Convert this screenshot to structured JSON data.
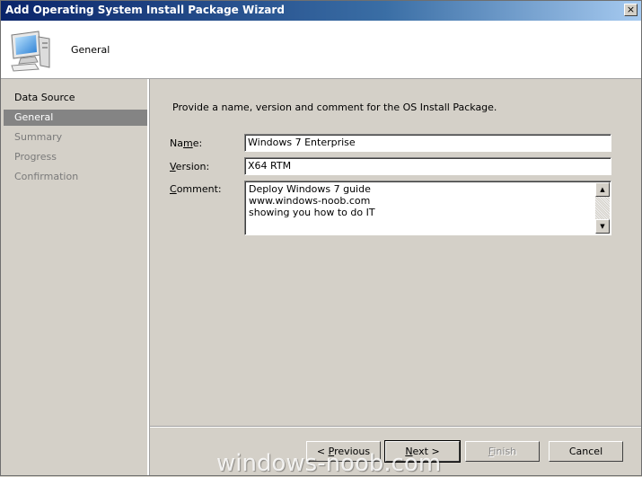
{
  "window": {
    "title": "Add Operating System Install Package Wizard",
    "close_glyph": "×"
  },
  "header": {
    "page_title": "General",
    "icon": "computer-monitor-icon"
  },
  "sidebar": {
    "steps": [
      {
        "label": "Data Source",
        "state": "completed"
      },
      {
        "label": "General",
        "state": "current"
      },
      {
        "label": "Summary",
        "state": "pending"
      },
      {
        "label": "Progress",
        "state": "pending"
      },
      {
        "label": "Confirmation",
        "state": "pending"
      }
    ]
  },
  "content": {
    "intro": "Provide a name, version and comment for the OS Install Package.",
    "name": {
      "label_pre": "Na",
      "label_accel": "m",
      "label_post": "e:",
      "value": "Windows 7 Enterprise"
    },
    "version": {
      "label_pre": "",
      "label_accel": "V",
      "label_post": "ersion:",
      "value": "X64 RTM"
    },
    "comment": {
      "label_pre": "",
      "label_accel": "C",
      "label_post": "omment:",
      "lines": [
        "Deploy Windows 7 guide",
        "www.windows-noob.com",
        "showing you how to do IT"
      ]
    },
    "scroll_up_glyph": "▲",
    "scroll_down_glyph": "▼"
  },
  "buttons": {
    "previous_pre": "< ",
    "previous_accel": "P",
    "previous_post": "revious",
    "next_pre": "",
    "next_accel": "N",
    "next_post": "ext >",
    "finish_pre": "",
    "finish_accel": "F",
    "finish_post": "inish",
    "cancel": "Cancel"
  },
  "watermark": "windows-noob.com"
}
